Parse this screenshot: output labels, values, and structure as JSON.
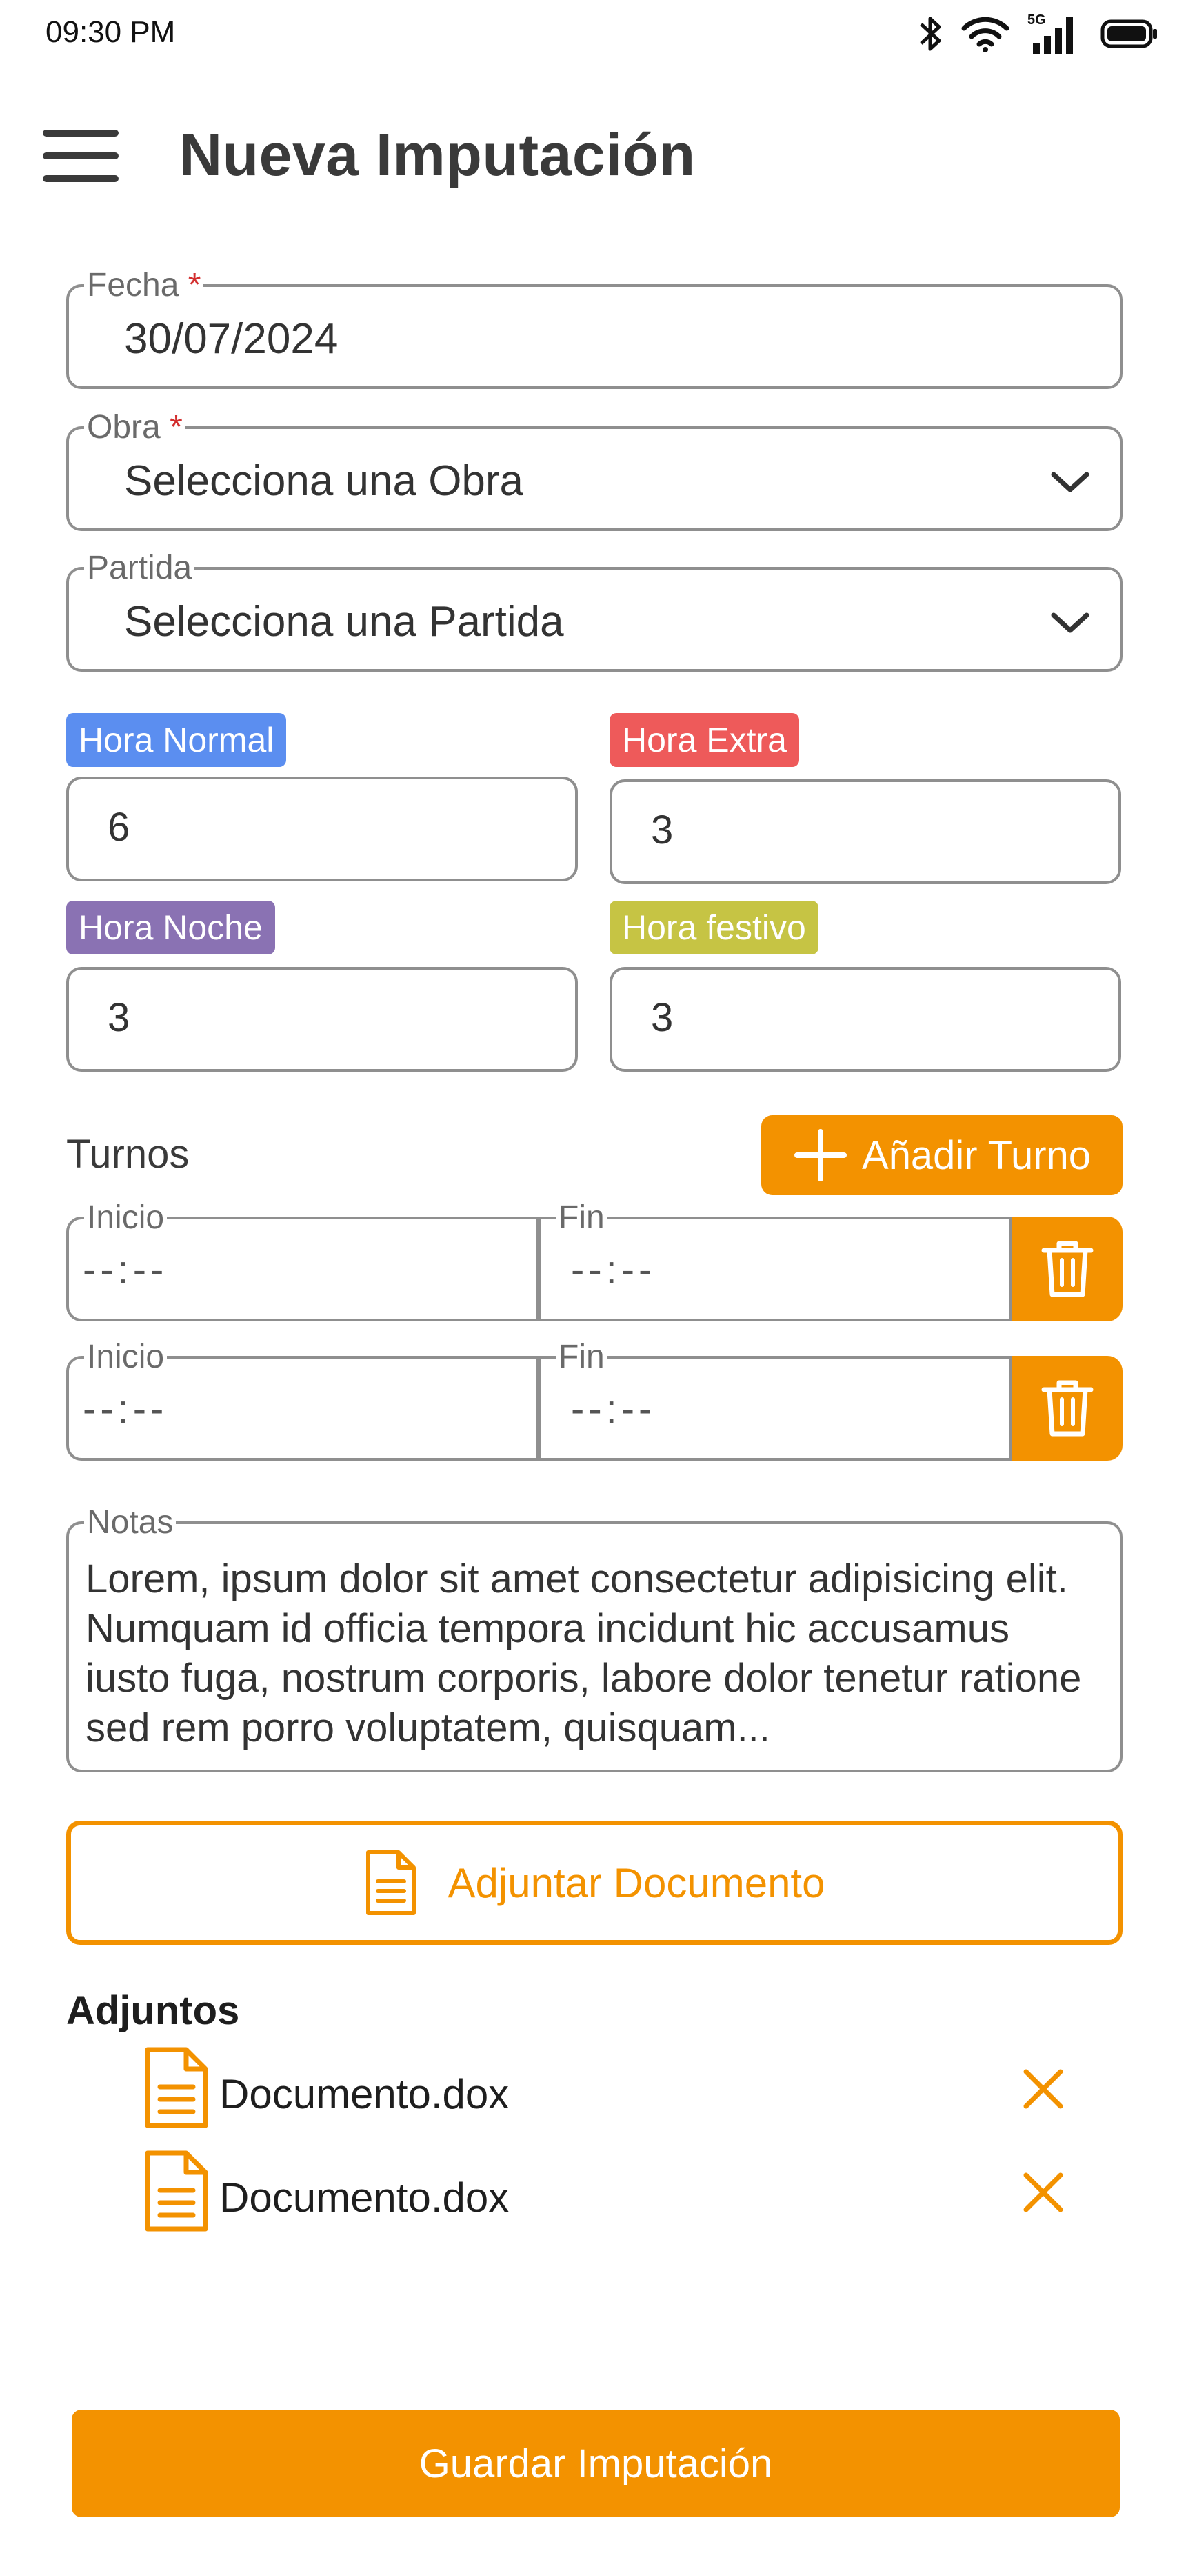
{
  "status_bar": {
    "time": "09:30 PM",
    "network_label": "5G"
  },
  "header": {
    "title": "Nueva Imputación"
  },
  "form": {
    "fecha": {
      "label": "Fecha",
      "required_mark": "*",
      "value": "30/07/2024"
    },
    "obra": {
      "label": "Obra",
      "required_mark": "*",
      "value": "Selecciona una Obra"
    },
    "partida": {
      "label": "Partida",
      "value": "Selecciona una Partida"
    },
    "hours": [
      {
        "label": "Hora Normal",
        "value": "6",
        "color": "#5b8ef0"
      },
      {
        "label": "Hora Extra",
        "value": "3",
        "color": "#ee5a5a"
      },
      {
        "label": "Hora Noche",
        "value": "3",
        "color": "#8a72b3"
      },
      {
        "label": "Hora festivo",
        "value": "3",
        "color": "#c6c444"
      }
    ],
    "turnos": {
      "label": "Turnos",
      "add_label": "Añadir Turno",
      "rows": [
        {
          "inicio_label": "Inicio",
          "inicio_placeholder": "--:--",
          "fin_label": "Fin",
          "fin_placeholder": "--:--"
        },
        {
          "inicio_label": "Inicio",
          "inicio_placeholder": "--:--",
          "fin_label": "Fin",
          "fin_placeholder": "--:--"
        }
      ]
    },
    "notas": {
      "label": "Notas",
      "value": "Lorem, ipsum dolor sit amet consectetur adipisicing elit. Numquam id officia tempora incidunt hic accusamus iusto fuga, nostrum corporis, labore dolor tenetur ratione sed rem porro voluptatem, quisquam..."
    },
    "attach_label": "Adjuntar Documento",
    "adjuntos": {
      "title": "Adjuntos",
      "items": [
        {
          "name": "Documento.dox"
        },
        {
          "name": "Documento.dox"
        }
      ]
    },
    "save_label": "Guardar Imputación"
  },
  "colors": {
    "accent": "#f39200",
    "border": "#8f8f8f",
    "required": "#d32f2f"
  }
}
